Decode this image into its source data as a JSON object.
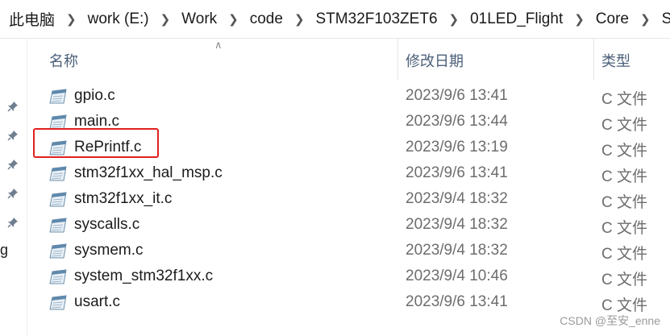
{
  "breadcrumb": [
    "此电脑",
    "work (E:)",
    "Work",
    "code",
    "STM32F103ZET6",
    "01LED_Flight",
    "Core",
    "Src"
  ],
  "columns": {
    "name": "名称",
    "modified": "修改日期",
    "type": "类型"
  },
  "files": [
    {
      "name": "gpio.c",
      "modified": "2023/9/6 13:41",
      "type": "C 文件"
    },
    {
      "name": "main.c",
      "modified": "2023/9/6 13:44",
      "type": "C 文件"
    },
    {
      "name": "RePrintf.c",
      "modified": "2023/9/6 13:19",
      "type": "C 文件",
      "highlighted": true
    },
    {
      "name": "stm32f1xx_hal_msp.c",
      "modified": "2023/9/6 13:41",
      "type": "C 文件"
    },
    {
      "name": "stm32f1xx_it.c",
      "modified": "2023/9/4 18:32",
      "type": "C 文件"
    },
    {
      "name": "syscalls.c",
      "modified": "2023/9/4 18:32",
      "type": "C 文件"
    },
    {
      "name": "sysmem.c",
      "modified": "2023/9/4 18:32",
      "type": "C 文件"
    },
    {
      "name": "system_stm32f1xx.c",
      "modified": "2023/9/4 10:46",
      "type": "C 文件"
    },
    {
      "name": "usart.c",
      "modified": "2023/9/6 13:41",
      "type": "C 文件"
    }
  ],
  "left_pane": {
    "cutoff_text": "g"
  },
  "watermark": "CSDN @至安_enne",
  "colors": {
    "highlight": "#e0201f",
    "header_text": "#4c607a"
  }
}
